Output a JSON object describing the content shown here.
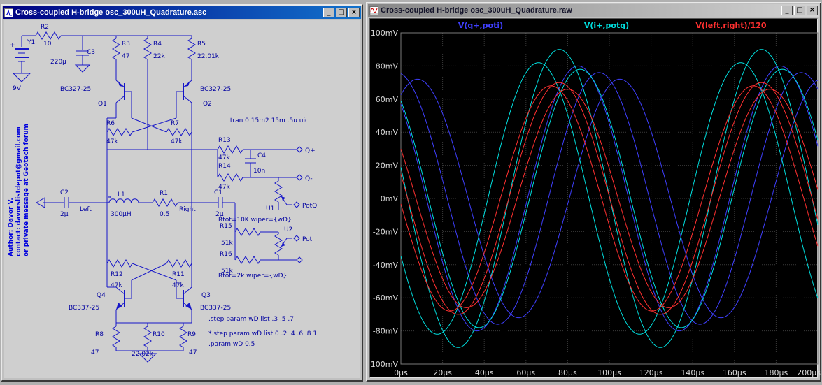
{
  "window_controls": {
    "minimize": "_",
    "maximize": "□",
    "close": "×"
  },
  "left_window": {
    "title": "Cross-coupled H-bridge osc_300uH_Quadrature.asc",
    "sch": {
      "plus": "+",
      "y1": "Y1",
      "y1v": "9V",
      "r2": "R2",
      "r2v": "10",
      "c3": "C3",
      "c3v": "220µ",
      "r3": "R3",
      "r3v": "47",
      "r4": "R4",
      "r4v": "22k",
      "r5": "R5",
      "r5v": "22.01k",
      "q1": "Q1",
      "q1t": "BC327-25",
      "q2": "Q2",
      "q2t": "BC327-25",
      "r6": "R6",
      "r6v": "47k",
      "r7": "R7",
      "r7v": "47k",
      "r13": "R13",
      "r13v": "47k",
      "r14": "R14",
      "r14v": "47k",
      "c4": "C4",
      "c4v": "10n",
      "qp": "Q+",
      "qm": "Q-",
      "u1": "U1",
      "potq": "PotQ",
      "rtotq": "Rtot=10K wiper={wD}",
      "c2": "C2",
      "c2v": "2µ",
      "left": "Left",
      "l1": "L1",
      "l1v": "300µH",
      "r1": "R1",
      "r1v": "0.5",
      "right": "Right",
      "c1": "C1",
      "c1v": "2µ",
      "r15": "R15",
      "r15v": "51k",
      "u2": "U2",
      "poti": "PotI",
      "r16": "R16",
      "r16v": "51k",
      "rtoti": "Rtot=2k wiper={wD}",
      "r12": "R12",
      "r12v": "47k",
      "r11": "R11",
      "r11v": "47k",
      "q4": "Q4",
      "q4t": "BC337-25",
      "q3": "Q3",
      "q3t": "BC337-25",
      "r8": "R8",
      "r8v": "47",
      "r10": "R10",
      "r10v": "22.02k",
      "r9": "R9",
      "r9v": "47",
      "tran": ".tran 0 15m2 15m .5u uic",
      "step1": ".step param wD list .3 .5 .7",
      "step2": "*.step param wD list 0 .2 .4 .6 .8 1",
      "param": ".param wD 0.5",
      "author1": "Author: Davor V.",
      "author2": "contact: davorslistdepot@gmail.com",
      "author3": "or private message at Geotech forum"
    }
  },
  "right_window": {
    "title": "Cross-coupled H-bridge osc_300uH_Quadrature.raw"
  },
  "chart_data": {
    "type": "line",
    "x_unit": "µs",
    "y_unit": "mV",
    "xlim": [
      0,
      200
    ],
    "ylim": [
      -100,
      100
    ],
    "x_ticks": [
      "0µs",
      "20µs",
      "40µs",
      "60µs",
      "80µs",
      "100µs",
      "120µs",
      "140µs",
      "160µs",
      "180µs",
      "200µs"
    ],
    "y_ticks": [
      "100mV",
      "80mV",
      "60mV",
      "40mV",
      "20mV",
      "0mV",
      "-20mV",
      "-40mV",
      "-60mV",
      "-80mV",
      "-100mV"
    ],
    "grid": true,
    "legend_position": "top",
    "colors": {
      "background": "#000000",
      "grid": "#3a3a3a",
      "frame": "#7a7a7a",
      "tick_text": "#d8d8d8"
    },
    "series": [
      {
        "name": "V(q+,poti)",
        "color": "#3f3fff",
        "waveform": "sine",
        "period_us": 97,
        "curves": [
          {
            "amplitude_mv": 80,
            "peak_us": 85
          },
          {
            "amplitude_mv": 76,
            "peak_us": 95
          },
          {
            "amplitude_mv": 72,
            "peak_us": 105
          }
        ]
      },
      {
        "name": "V(i+,potq)",
        "color": "#00dede",
        "waveform": "sine",
        "period_us": 97,
        "curves": [
          {
            "amplitude_mv": 90,
            "peak_us": 76
          },
          {
            "amplitude_mv": 82,
            "peak_us": 66
          },
          {
            "amplitude_mv": 78,
            "peak_us": 86
          }
        ]
      },
      {
        "name": "V(left,right)/120",
        "color": "#ff3030",
        "waveform": "sine",
        "period_us": 97,
        "curves": [
          {
            "amplitude_mv": 70,
            "peak_us": 76
          },
          {
            "amplitude_mv": 68,
            "peak_us": 72
          },
          {
            "amplitude_mv": 66,
            "peak_us": 80
          }
        ]
      }
    ]
  }
}
